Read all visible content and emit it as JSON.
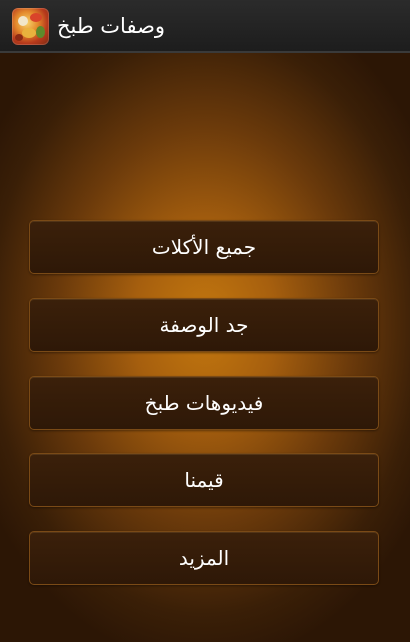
{
  "app": {
    "title": "وصفات طبخ",
    "icon": "food-dish-icon"
  },
  "menu": {
    "items": [
      {
        "label": "جميع الأكلات"
      },
      {
        "label": "جد الوصفة"
      },
      {
        "label": "فيديوهات طبخ"
      },
      {
        "label": "قيمنا"
      },
      {
        "label": "المزيد"
      }
    ]
  },
  "colors": {
    "action_bar": "#222222",
    "background_center": "#c4780f",
    "background_edge": "#2c1605",
    "button_fill": "#341c08",
    "button_border": "#7a4a16",
    "text": "#ffffff"
  }
}
